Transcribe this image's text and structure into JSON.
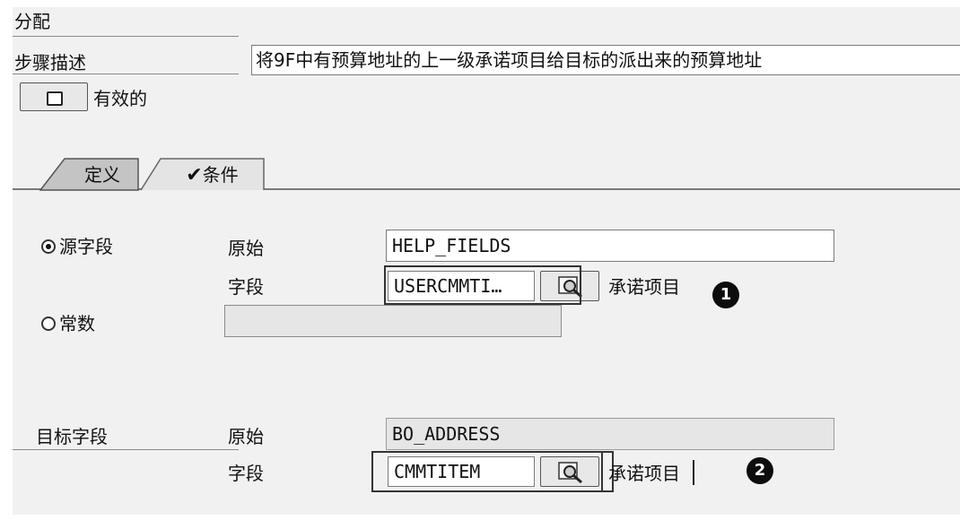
{
  "header": {
    "assignment_label": "分配",
    "step_desc_label": "步骤描述",
    "step_desc_value": "将9F中有预算地址的上一级承诺项目给目标的派出来的预算地址",
    "active_label": "有效的"
  },
  "tabs": [
    {
      "label": "定义",
      "active": true
    },
    {
      "label": "条件",
      "active": false,
      "icon": "checkmark-icon"
    }
  ],
  "source": {
    "radio_label": "源字段",
    "selected": true,
    "origin_label": "原始",
    "origin_value": "HELP_FIELDS",
    "field_label": "字段",
    "field_value": "USERCMMTI…",
    "field_desc": "承诺项目",
    "badge": "1"
  },
  "constant": {
    "radio_label": "常数",
    "selected": false,
    "value": ""
  },
  "target": {
    "label": "目标字段",
    "origin_label": "原始",
    "origin_value": "BO_ADDRESS",
    "field_label": "字段",
    "field_value": "CMMTITEM",
    "field_desc": "承诺项目",
    "badge": "2"
  }
}
